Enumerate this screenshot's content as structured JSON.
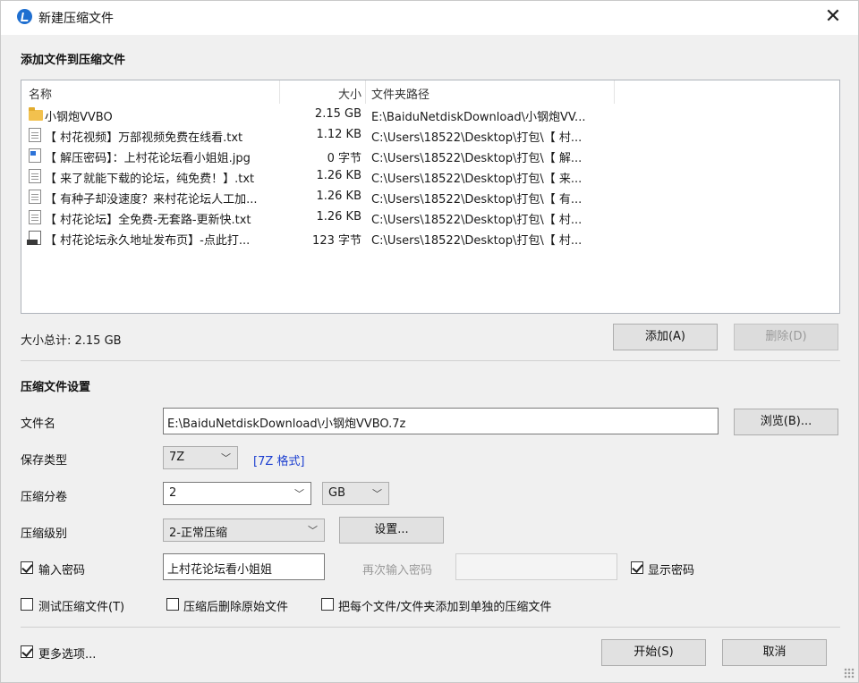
{
  "window": {
    "title": "新建压缩文件",
    "close_glyph": "✕"
  },
  "files_section": {
    "title": "添加文件到压缩文件"
  },
  "file_list": {
    "columns": [
      "名称",
      "大小",
      "文件夹路径"
    ],
    "rows": [
      {
        "icon": "folder-icon",
        "name": "小钢炮VVBO",
        "size": "2.15 GB",
        "path": "E:\\BaiduNetdiskDownload\\小钢炮VV..."
      },
      {
        "icon": "text-file-icon",
        "name": "【 村花视频】万部视频免费在线看.txt",
        "size": "1.12 KB",
        "path": "C:\\Users\\18522\\Desktop\\打包\\【 村..."
      },
      {
        "icon": "image-file-icon",
        "name": "【 解压密码】：上村花论坛看小姐姐.jpg",
        "size": "0 字节",
        "path": "C:\\Users\\18522\\Desktop\\打包\\【 解..."
      },
      {
        "icon": "text-file-icon",
        "name": "【 来了就能下载的论坛，纯免费！】.txt",
        "size": "1.26 KB",
        "path": "C:\\Users\\18522\\Desktop\\打包\\【 来..."
      },
      {
        "icon": "text-file-icon",
        "name": "【 有种子却没速度？来村花论坛人工加...",
        "size": "1.26 KB",
        "path": "C:\\Users\\18522\\Desktop\\打包\\【 有..."
      },
      {
        "icon": "text-file-icon",
        "name": "【 村花论坛】全免费-无套路-更新快.txt",
        "size": "1.26 KB",
        "path": "C:\\Users\\18522\\Desktop\\打包\\【 村..."
      },
      {
        "icon": "shortcut-file-icon",
        "name": "【 村花论坛永久地址发布页】-点此打...",
        "size": "123 字节",
        "path": "C:\\Users\\18522\\Desktop\\打包\\【 村..."
      }
    ]
  },
  "total_size": "大小总计: 2.15 GB",
  "buttons": {
    "add": "添加(A)",
    "delete": "删除(D)",
    "browse": "浏览(B)...",
    "settings": "设置...",
    "start": "开始(S)",
    "cancel": "取消"
  },
  "settings_section": {
    "title": "压缩文件设置",
    "filename_label": "文件名",
    "filename_value": "E:\\BaiduNetdiskDownload\\小钢炮VVBO.7z",
    "save_type_label": "保存类型",
    "save_type_value": "7Z",
    "save_type_link": "[7Z 格式]",
    "split_label": "压缩分卷",
    "split_value": "2",
    "split_unit": "GB",
    "level_label": "压缩级别",
    "level_value": "2-正常压缩",
    "password_label": "输入密码",
    "password_checked": true,
    "password_value": "上村花论坛看小姐姐",
    "repeat_password_label": "再次输入密码",
    "repeat_password_value": "",
    "show_password_label": "显示密码",
    "show_password_checked": true,
    "test_label": "测试压缩文件(T)",
    "test_checked": false,
    "delete_after_label": "压缩后删除原始文件",
    "delete_after_checked": false,
    "separate_label": "把每个文件/文件夹添加到单独的压缩文件",
    "separate_checked": false
  },
  "more_options": {
    "label": "更多选项...",
    "checked": true
  }
}
